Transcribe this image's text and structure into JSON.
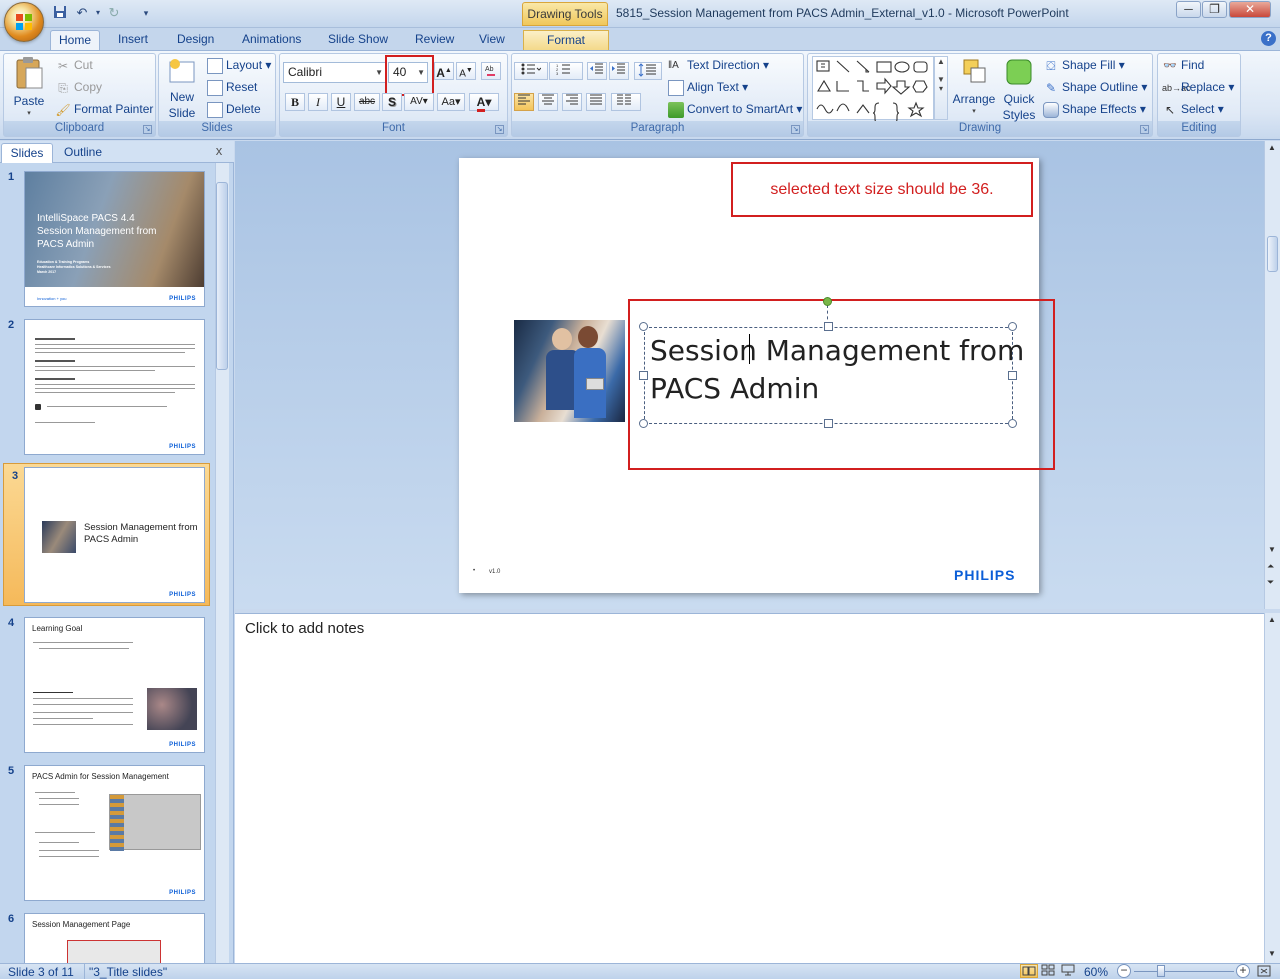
{
  "window": {
    "contextual_tab_group": "Drawing Tools",
    "title": "5815_Session Management from PACS Admin_External_v1.0 - Microsoft PowerPoint",
    "minimize": "─",
    "maximize": "❐",
    "close": "✕"
  },
  "tabs": [
    "Home",
    "Insert",
    "Design",
    "Animations",
    "Slide Show",
    "Review",
    "View",
    "Format"
  ],
  "ribbon": {
    "clipboard": {
      "label": "Clipboard",
      "paste": "Paste",
      "cut": "Cut",
      "copy": "Copy",
      "format_painter": "Format Painter"
    },
    "slides": {
      "label": "Slides",
      "new_slide_line1": "New",
      "new_slide_line2": "Slide",
      "layout": "Layout",
      "reset": "Reset",
      "delete": "Delete"
    },
    "font": {
      "label": "Font",
      "font_name": "Calibri",
      "font_size": "40",
      "bold": "B",
      "italic": "I",
      "underline": "U",
      "strike": "abc",
      "shadow": "S",
      "spacing": "AV",
      "case": "Aa",
      "grow": "A",
      "shrink": "A",
      "color": "A"
    },
    "paragraph": {
      "label": "Paragraph",
      "text_direction": "Text Direction",
      "align_text": "Align Text",
      "smartart": "Convert to SmartArt"
    },
    "drawing": {
      "label": "Drawing",
      "arrange": "Arrange",
      "quick_styles_1": "Quick",
      "quick_styles_2": "Styles",
      "shape_fill": "Shape Fill",
      "shape_outline": "Shape Outline",
      "shape_effects": "Shape Effects"
    },
    "editing": {
      "label": "Editing",
      "find": "Find",
      "replace": "Replace",
      "select": "Select"
    }
  },
  "pane": {
    "slides_tab": "Slides",
    "outline_tab": "Outline",
    "close": "x"
  },
  "thumbnails": [
    {
      "num": "1",
      "title": "IntelliSpace PACS 4.4 Session Management from PACS Admin",
      "sub1": "Education & Training Programs",
      "sub2": "Healthcare Informatics Solutions & Services",
      "sub3": "March 2017",
      "footer": "Innovation + you",
      "brand": "PHILIPS"
    },
    {
      "num": "2",
      "brand": "PHILIPS"
    },
    {
      "num": "3",
      "title": "Session Management from PACS Admin",
      "brand": "PHILIPS"
    },
    {
      "num": "4",
      "title": "Learning Goal",
      "brand": "PHILIPS"
    },
    {
      "num": "5",
      "title": "PACS Admin for Session Management",
      "brand": "PHILIPS"
    },
    {
      "num": "6",
      "title": "Session Management Page"
    }
  ],
  "slide": {
    "annotation": "selected text size should be 36.",
    "title_line1": "Session Management from",
    "title_line2": "PACS Admin",
    "version": "v1.0",
    "bullet": "•",
    "brand": "PHILIPS"
  },
  "notes": {
    "placeholder": "Click to add notes"
  },
  "status": {
    "slide": "Slide 3 of 11",
    "theme": "\"3_Title slides\"",
    "zoom": "60%"
  },
  "colors": {
    "accent_red": "#d21f1f",
    "philips_blue": "#0b5ed7",
    "selected_thumb": "#f5b95a"
  }
}
